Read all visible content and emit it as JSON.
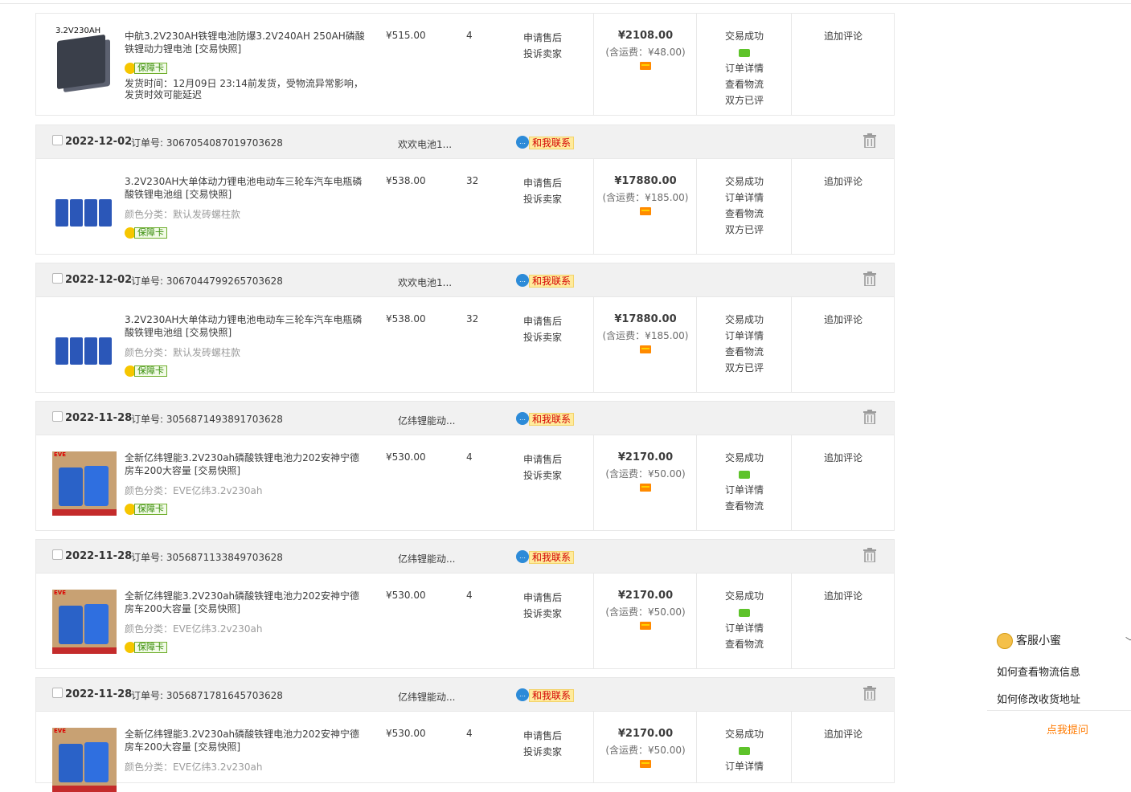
{
  "orders": [
    {
      "has_header": false,
      "product": {
        "title": "中航3.2V230AH铁锂电池防爆3.2V240AH 250AH磷酸铁锂动力锂电池 [交易快照]",
        "thumb_label": "3.2V230AH",
        "guarantee": "保障卡",
        "spec": "",
        "ship_note": "发货时间：12月09日 23:14前发货，受物流异常影响，发货时效可能延迟"
      },
      "price": "¥515.00",
      "qty": "4",
      "after_sale": [
        "申请售后",
        "投诉卖家"
      ],
      "total": "¥2108.00",
      "shipping": "(含运费：¥48.00)",
      "status": [
        "交易成功",
        "订单详情",
        "查看物流",
        "双方已评"
      ],
      "status_has_msg": true,
      "review": "追加评论"
    },
    {
      "has_header": true,
      "date": "2022-12-02",
      "order_no": "订单号: 3067054087019703628",
      "shop": "欢欢电池1...",
      "contact": "和我联系",
      "product": {
        "title": "3.2V230AH大单体动力锂电池电动车三轮车汽车电瓶磷酸铁锂电池组 [交易快照]",
        "thumb_label": "",
        "guarantee": "保障卡",
        "spec": "颜色分类：默认发砖螺柱款",
        "ship_note": ""
      },
      "price": "¥538.00",
      "qty": "32",
      "after_sale": [
        "申请售后",
        "投诉卖家"
      ],
      "total": "¥17880.00",
      "shipping": "(含运费：¥185.00)",
      "status": [
        "交易成功",
        "订单详情",
        "查看物流",
        "双方已评"
      ],
      "status_has_msg": false,
      "review": "追加评论"
    },
    {
      "has_header": true,
      "date": "2022-12-02",
      "order_no": "订单号: 3067044799265703628",
      "shop": "欢欢电池1...",
      "contact": "和我联系",
      "product": {
        "title": "3.2V230AH大单体动力锂电池电动车三轮车汽车电瓶磷酸铁锂电池组 [交易快照]",
        "thumb_label": "",
        "guarantee": "保障卡",
        "spec": "颜色分类：默认发砖螺柱款",
        "ship_note": ""
      },
      "price": "¥538.00",
      "qty": "32",
      "after_sale": [
        "申请售后",
        "投诉卖家"
      ],
      "total": "¥17880.00",
      "shipping": "(含运费：¥185.00)",
      "status": [
        "交易成功",
        "订单详情",
        "查看物流",
        "双方已评"
      ],
      "status_has_msg": false,
      "review": "追加评论"
    },
    {
      "has_header": true,
      "date": "2022-11-28",
      "order_no": "订单号: 3056871493891703628",
      "shop": "亿纬锂能动...",
      "contact": "和我联系",
      "product": {
        "title": "全新亿纬锂能3.2V230ah磷酸铁锂电池力202安神宁德房车200大容量 [交易快照]",
        "thumb_label": "EVE",
        "guarantee": "保障卡",
        "spec": "颜色分类：EVE亿纬3.2v230ah",
        "ship_note": ""
      },
      "price": "¥530.00",
      "qty": "4",
      "after_sale": [
        "申请售后",
        "投诉卖家"
      ],
      "total": "¥2170.00",
      "shipping": "(含运费：¥50.00)",
      "status": [
        "交易成功",
        "订单详情",
        "查看物流"
      ],
      "status_has_msg": true,
      "review": "追加评论"
    },
    {
      "has_header": true,
      "date": "2022-11-28",
      "order_no": "订单号: 3056871133849703628",
      "shop": "亿纬锂能动...",
      "contact": "和我联系",
      "product": {
        "title": "全新亿纬锂能3.2V230ah磷酸铁锂电池力202安神宁德房车200大容量 [交易快照]",
        "thumb_label": "EVE",
        "guarantee": "保障卡",
        "spec": "颜色分类：EVE亿纬3.2v230ah",
        "ship_note": ""
      },
      "price": "¥530.00",
      "qty": "4",
      "after_sale": [
        "申请售后",
        "投诉卖家"
      ],
      "total": "¥2170.00",
      "shipping": "(含运费：¥50.00)",
      "status": [
        "交易成功",
        "订单详情",
        "查看物流"
      ],
      "status_has_msg": true,
      "review": "追加评论"
    },
    {
      "has_header": true,
      "date": "2022-11-28",
      "order_no": "订单号: 3056871781645703628",
      "shop": "亿纬锂能动...",
      "contact": "和我联系",
      "product": {
        "title": "全新亿纬锂能3.2V230ah磷酸铁锂电池力202安神宁德房车200大容量 [交易快照]",
        "thumb_label": "EVE",
        "guarantee": "",
        "spec": "颜色分类：EVE亿纬3.2v230ah",
        "ship_note": ""
      },
      "price": "¥530.00",
      "qty": "4",
      "after_sale": [
        "申请售后",
        "投诉卖家"
      ],
      "total": "¥2170.00",
      "shipping": "(含运费：¥50.00)",
      "status": [
        "交易成功",
        "订单详情"
      ],
      "status_has_msg": true,
      "review": "追加评论"
    }
  ],
  "service": {
    "title": "客服小蜜",
    "questions": [
      "如何查看物流信息",
      "如何修改收货地址"
    ],
    "ask": "点我提问"
  }
}
